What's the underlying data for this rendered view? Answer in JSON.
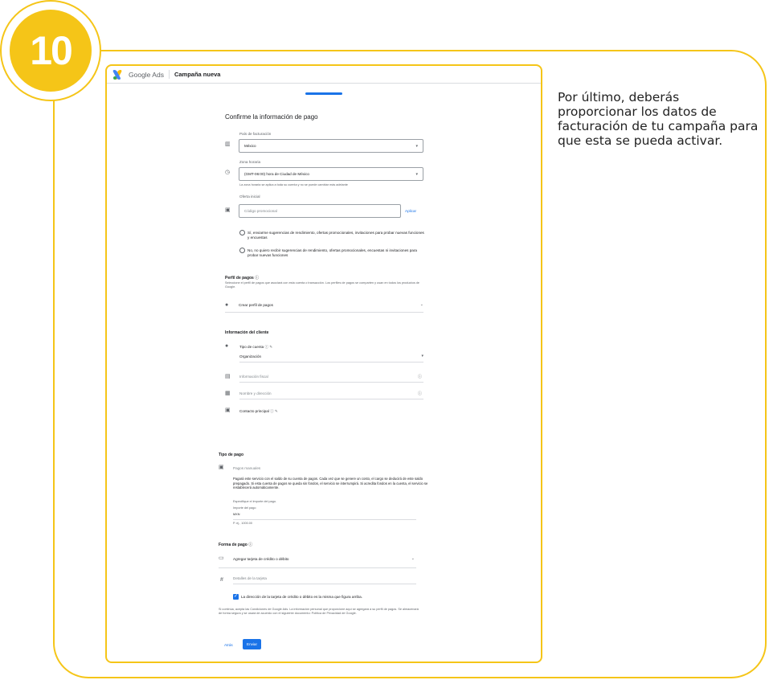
{
  "step": {
    "number": "10"
  },
  "description": "Por último, deberás proporcionar los datos de facturación de tu campaña para que esta se pueda activar.",
  "colors": {
    "accent_yellow": "#f5c518",
    "google_blue": "#1a73e8"
  },
  "app": {
    "brand": "Google Ads",
    "window_title": "Campaña nueva"
  },
  "payment": {
    "title": "Confirme la información de pago",
    "country": {
      "label": "País de facturación",
      "value": "México"
    },
    "timezone": {
      "label": "Zona horaria",
      "value": "(GMT-06:00) hora de Ciudad de México",
      "help": "La zona horaria se aplica a toda su cuenta y no se puede cambiar más adelante"
    },
    "offer": {
      "label": "Oferta inicial",
      "placeholder": "Código promocional",
      "apply": "Aplicar"
    },
    "radios": [
      {
        "text": "Sí, enviarme sugerencias de rendimiento, ofertas promocionales, invitaciones para probar nuevas funciones y encuestas"
      },
      {
        "text": "No, no quiero recibir sugerencias de rendimiento, ofertas promocionales, encuestas ni invitaciones para probar nuevas funciones"
      }
    ]
  },
  "profile": {
    "title": "Perfil de pagos",
    "desc": "Seleccione el perfil de pagos que asociará con esta cuenta o transacción. Los perfiles de pagos se comparten y usan en todos los productos de Google.",
    "create": "Crear perfil de pagos"
  },
  "customer": {
    "title": "Información del cliente",
    "account_type": {
      "label": "Tipo de cuenta",
      "value": "Organización"
    },
    "tax_info": "Información fiscal",
    "name_address": "Nombre y dirección",
    "main_contact": "Contacto principal"
  },
  "payment_type": {
    "title": "Tipo de pago",
    "method": "Pagos manuales",
    "desc": "Pagará este servicio con el saldo de su cuenta de pagos. Cada vez que se genere un costo, el cargo se deducirá de este saldo prepagado. Si esta cuenta de pagos se queda sin fondos, el servicio se interrumpirá. Si acredita fondos en la cuenta, el servicio se restablecerá automáticamente.",
    "specify": "Especifique el importe del pago.",
    "amount_label": "Importe del pago",
    "currency": "MXN",
    "example": "P. ej., 1000.00"
  },
  "payment_form": {
    "title": "Forma de pago",
    "add_card": "Agregar tarjeta de crédito o débito",
    "card_details": "Detalles de la tarjeta",
    "checkbox_text": "La dirección de la tarjeta de crédito o débito es la misma que figura arriba.",
    "terms": "Si continúa, acepta las Condiciones de Google Ads. La información personal que proporcione aquí se agregará a su perfil de pagos. Se almacenará de forma segura y se usará de acuerdo con el siguiente documento: Política de Privacidad de Google."
  },
  "actions": {
    "back": "Atrás",
    "submit": "Enviar"
  }
}
